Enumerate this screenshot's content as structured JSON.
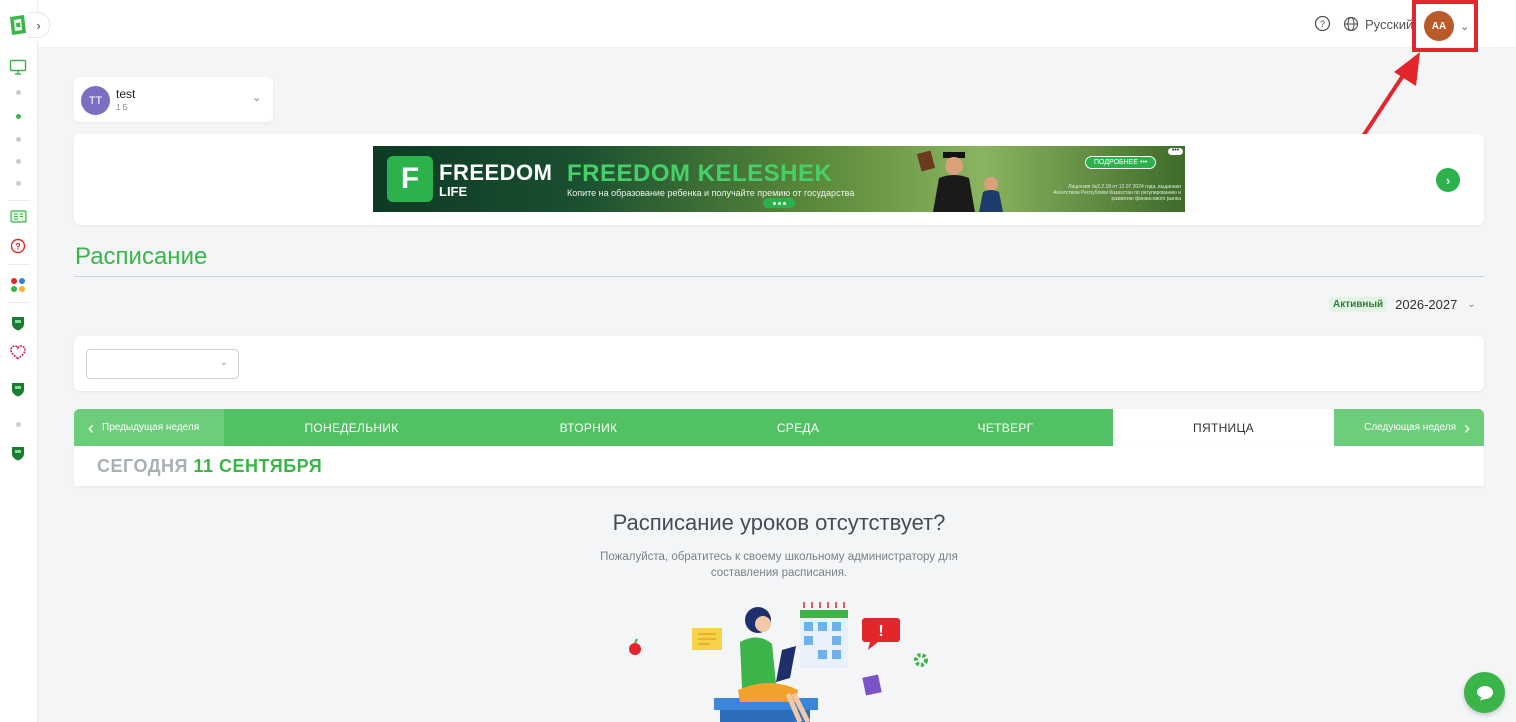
{
  "header": {
    "language": "Русский",
    "user_initials": "AA"
  },
  "student": {
    "initials": "TT",
    "name": "test",
    "class": "1 Б"
  },
  "banner": {
    "brand_line1": "FREEDOM",
    "brand_line2": "LIFE",
    "title": "FREEDOM KELESHEK",
    "subtitle": "Копите на образование ребенка и получайте премию от государства",
    "cta": "ПОДРОБНЕЕ •••",
    "legal": "Лицензия №2.2.18 от 12.07.2024 года, выданная Агентством Республики Казахстан по регулированию и развитию финансового рынка"
  },
  "schedule": {
    "title": "Расписание",
    "year_status": "Активный",
    "year": "2026-2027",
    "prev_week": "Предыдущая неделя",
    "next_week": "Следующая неделя",
    "days": [
      {
        "label": "ПОНЕДЕЛЬНИК",
        "active": false
      },
      {
        "label": "ВТОРНИК",
        "active": false
      },
      {
        "label": "СРЕДА",
        "active": false
      },
      {
        "label": "ЧЕТВЕРГ",
        "active": false
      },
      {
        "label": "ПЯТНИЦА",
        "active": true
      }
    ],
    "today_prefix": "СЕГОДНЯ",
    "today_date": "11 СЕНТЯБРЯ"
  },
  "empty_state": {
    "title": "Расписание уроков отсутствует?",
    "text": "Пожалуйста, обратитесь к своему школьному администратору для составления расписания."
  },
  "colors": {
    "brand_green": "#3bb54a",
    "tab_green": "#52c163",
    "avatar_bg": "#b85a2a",
    "annotation_red": "#e3262b"
  }
}
